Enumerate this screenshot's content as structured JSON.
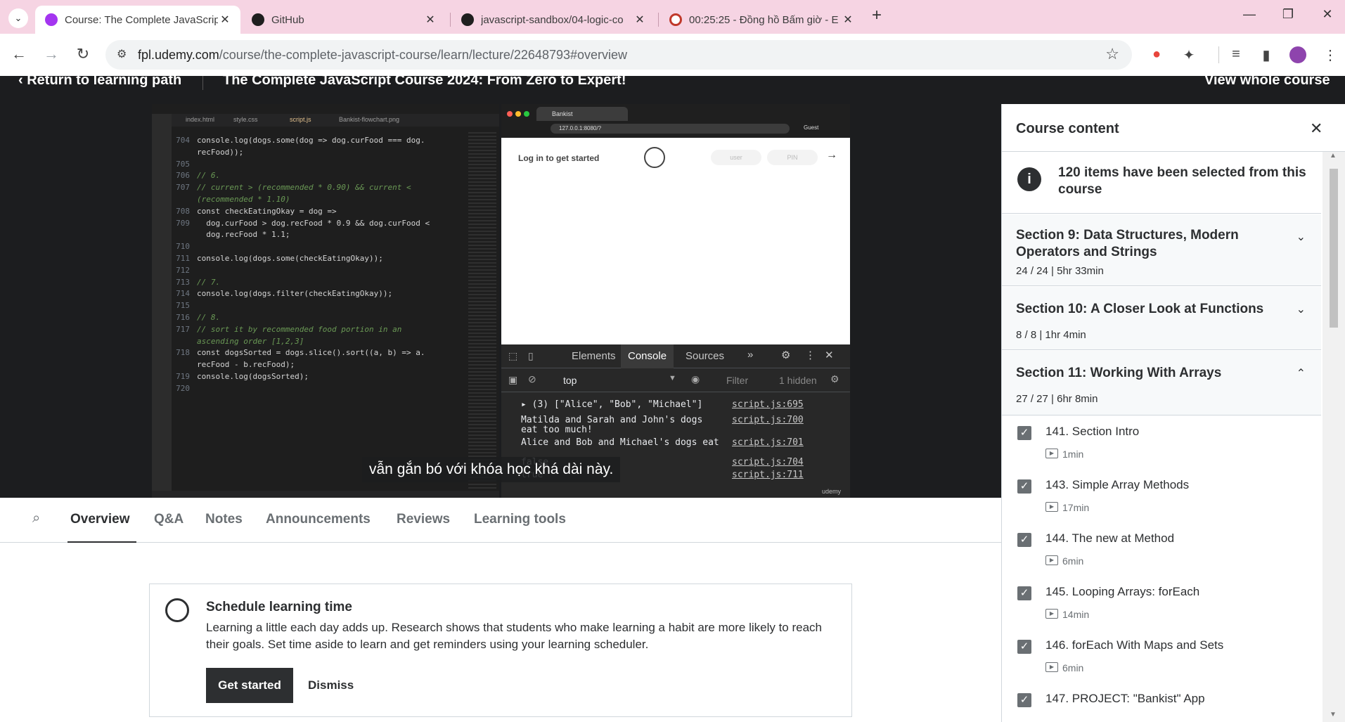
{
  "browser": {
    "tabs": [
      {
        "title": "Course: The Complete JavaScript",
        "active": true
      },
      {
        "title": "GitHub",
        "active": false
      },
      {
        "title": "javascript-sandbox/04-logic-co",
        "active": false
      },
      {
        "title": "00:25:25 - Đồng hồ Bấm giờ - E",
        "active": false
      }
    ],
    "new_tab_label": "+",
    "url_host": "fpl.udemy.com",
    "url_path": "/course/the-complete-javascript-course/learn/lecture/22648793#overview"
  },
  "course_header": {
    "return_label": "Return to learning path",
    "course_title": "The Complete JavaScript Course 2024: From Zero to Expert!",
    "view_whole_label": "View whole course"
  },
  "video": {
    "editor_tabs": [
      "index.html",
      "style.css",
      "script.js",
      "Bankist-flowchart.png"
    ],
    "code_lines": [
      {
        "n": "704",
        "t": "console.log(dogs.some(dog => dog.curFood === dog.",
        "c": false
      },
      {
        "n": "",
        "t": "recFood));",
        "c": false
      },
      {
        "n": "705",
        "t": "",
        "c": false
      },
      {
        "n": "706",
        "t": "// 6.",
        "c": true
      },
      {
        "n": "707",
        "t": "// current > (recommended * 0.90) && current <",
        "c": true
      },
      {
        "n": "",
        "t": "(recommended * 1.10)",
        "c": true
      },
      {
        "n": "708",
        "t": "const checkEatingOkay = dog =>",
        "c": false
      },
      {
        "n": "709",
        "t": "  dog.curFood > dog.recFood * 0.9 && dog.curFood <",
        "c": false
      },
      {
        "n": "",
        "t": "  dog.recFood * 1.1;",
        "c": false
      },
      {
        "n": "710",
        "t": "",
        "c": false
      },
      {
        "n": "711",
        "t": "console.log(dogs.some(checkEatingOkay));",
        "c": false
      },
      {
        "n": "712",
        "t": "",
        "c": false
      },
      {
        "n": "713",
        "t": "// 7.",
        "c": true
      },
      {
        "n": "714",
        "t": "console.log(dogs.filter(checkEatingOkay));",
        "c": false
      },
      {
        "n": "715",
        "t": "",
        "c": false
      },
      {
        "n": "716",
        "t": "// 8.",
        "c": true
      },
      {
        "n": "717",
        "t": "// sort it by recommended food portion in an",
        "c": true
      },
      {
        "n": "",
        "t": "ascending order [1,2,3]",
        "c": true
      },
      {
        "n": "718",
        "t": "const dogsSorted = dogs.slice().sort((a, b) => a.",
        "c": false
      },
      {
        "n": "",
        "t": "recFood - b.recFood);",
        "c": false
      },
      {
        "n": "719",
        "t": "console.log(dogsSorted);",
        "c": false
      },
      {
        "n": "720",
        "t": "",
        "c": false
      }
    ],
    "mock_browser": {
      "tab_title": "Bankist",
      "address": "127.0.0.1:8080/?",
      "guest_label": "Guest",
      "login_prompt": "Log in to get started",
      "user_placeholder": "user",
      "pin_placeholder": "PIN",
      "arrow": "→"
    },
    "devtools": {
      "tabs": [
        "Elements",
        "Console",
        "Sources"
      ],
      "active_tab": "Console",
      "context": "top",
      "filter_placeholder": "Filter",
      "hidden_count": "1 hidden",
      "console_lines": [
        {
          "text": "▸ (3) [\"Alice\", \"Bob\", \"Michael\"]",
          "source": "script.js:695"
        },
        {
          "text": "Matilda and Sarah and John's dogs",
          "source": "script.js:700"
        },
        {
          "text": "eat too much!",
          "source": ""
        },
        {
          "text": "Alice and Bob and Michael's dogs eat",
          "source": "script.js:701"
        },
        {
          "text": "false",
          "source": "script.js:704"
        },
        {
          "text": "true",
          "source": "script.js:711"
        }
      ],
      "watermark": "udemy"
    },
    "subtitle": "vẫn gắn bó với khóa học khá dài này."
  },
  "lecture_tabs": [
    "Overview",
    "Q&A",
    "Notes",
    "Announcements",
    "Reviews",
    "Learning tools"
  ],
  "active_lecture_tab": "Overview",
  "schedule": {
    "title": "Schedule learning time",
    "body": "Learning a little each day adds up. Research shows that students who make learning a habit are more likely to reach their goals. Set time aside to learn and get reminders using your learning scheduler.",
    "primary_button": "Get started",
    "secondary_button": "Dismiss"
  },
  "sidebar": {
    "title": "Course content",
    "info_text": "120 items have been selected from this course",
    "sections": [
      {
        "title": "Section 9: Data Structures, Modern Operators and Strings",
        "meta": "24 / 24 | 5hr 33min",
        "expanded": false
      },
      {
        "title": "Section 10: A Closer Look at Functions",
        "meta": "8 / 8 | 1hr 4min",
        "expanded": false
      },
      {
        "title": "Section 11: Working With Arrays",
        "meta": "27 / 27 | 6hr 8min",
        "expanded": true
      }
    ],
    "lectures": [
      {
        "title": "141. Section Intro",
        "duration": "1min",
        "done": true
      },
      {
        "title": "143. Simple Array Methods",
        "duration": "17min",
        "done": true
      },
      {
        "title": "144. The new at Method",
        "duration": "6min",
        "done": true
      },
      {
        "title": "145. Looping Arrays: forEach",
        "duration": "14min",
        "done": true
      },
      {
        "title": "146. forEach With Maps and Sets",
        "duration": "6min",
        "done": true
      },
      {
        "title": "147. PROJECT: \"Bankist\" App",
        "duration": "",
        "done": true
      }
    ]
  },
  "colors": {
    "chrome_tabstrip": "#f6d4e3",
    "udemy_dark": "#1c1d1f",
    "devtools_bg": "#282828",
    "primary_button": "#2d2f31"
  }
}
